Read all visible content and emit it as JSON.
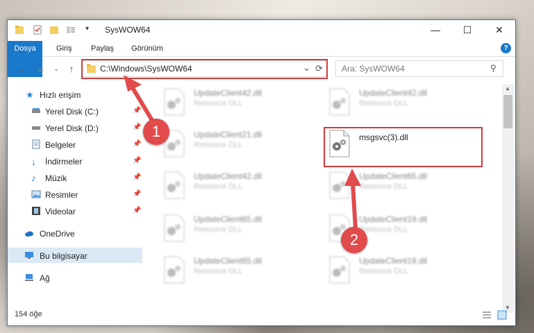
{
  "window": {
    "title": "SysWOW64",
    "minimize": "—",
    "maximize": "☐",
    "close": "✕"
  },
  "ribbon": {
    "tabs": [
      "Dosya",
      "Giriş",
      "Paylaş",
      "Görünüm"
    ],
    "help": "?"
  },
  "address": {
    "path": "C:\\Windows\\SysWOW64",
    "dropdown": "⌄",
    "refresh": "⟳",
    "search_placeholder": "Ara: SysWOW64"
  },
  "sidebar": {
    "items": [
      {
        "label": "Hızlı erişim",
        "icon": "star-icon"
      },
      {
        "label": "Yerel Disk (C:)",
        "icon": "drive-icon",
        "pinned": true
      },
      {
        "label": "Yerel Disk (D:)",
        "icon": "drive-icon",
        "pinned": true
      },
      {
        "label": "Belgeler",
        "icon": "documents-icon",
        "pinned": true
      },
      {
        "label": "İndirmeler",
        "icon": "download-icon",
        "pinned": true
      },
      {
        "label": "Müzik",
        "icon": "music-icon",
        "pinned": true
      },
      {
        "label": "Resimler",
        "icon": "pictures-icon",
        "pinned": true
      },
      {
        "label": "Videolar",
        "icon": "video-icon",
        "pinned": true
      },
      {
        "label": "OneDrive",
        "icon": "cloud-icon"
      },
      {
        "label": "Bu bilgisayar",
        "icon": "computer-icon",
        "selected": true
      },
      {
        "label": "Ağ",
        "icon": "network-icon"
      }
    ]
  },
  "files": [
    {
      "name": "UpdateClient42.dll",
      "type": "Resource DLL",
      "blurred": true
    },
    {
      "name": "UpdateClient42.dll",
      "type": "Resource DLL",
      "blurred": true
    },
    {
      "name": "UpdateClient21.dll",
      "type": "Resource DLL",
      "blurred": true
    },
    {
      "name": "msgsvc(3).dll",
      "type": "",
      "blurred": false
    },
    {
      "name": "UpdateClient42.dll",
      "type": "Resource DLL",
      "blurred": true
    },
    {
      "name": "UpdateClient65.dll",
      "type": "Resource DLL",
      "blurred": true
    },
    {
      "name": "UpdateClient65.dll",
      "type": "Resource DLL",
      "blurred": true
    },
    {
      "name": "UpdateClient19.dll",
      "type": "Resource DLL",
      "blurred": true
    },
    {
      "name": "UpdateClient65.dll",
      "type": "Resource DLL",
      "blurred": true
    },
    {
      "name": "UpdateClient19.dll",
      "type": "Resource DLL",
      "blurred": true
    }
  ],
  "status": {
    "count": "154 öğe"
  },
  "annotations": [
    {
      "label": "1"
    },
    {
      "label": "2"
    }
  ],
  "colors": {
    "accent": "#1979ca",
    "highlight": "#d33a3a",
    "selection": "#dbe9f7"
  }
}
